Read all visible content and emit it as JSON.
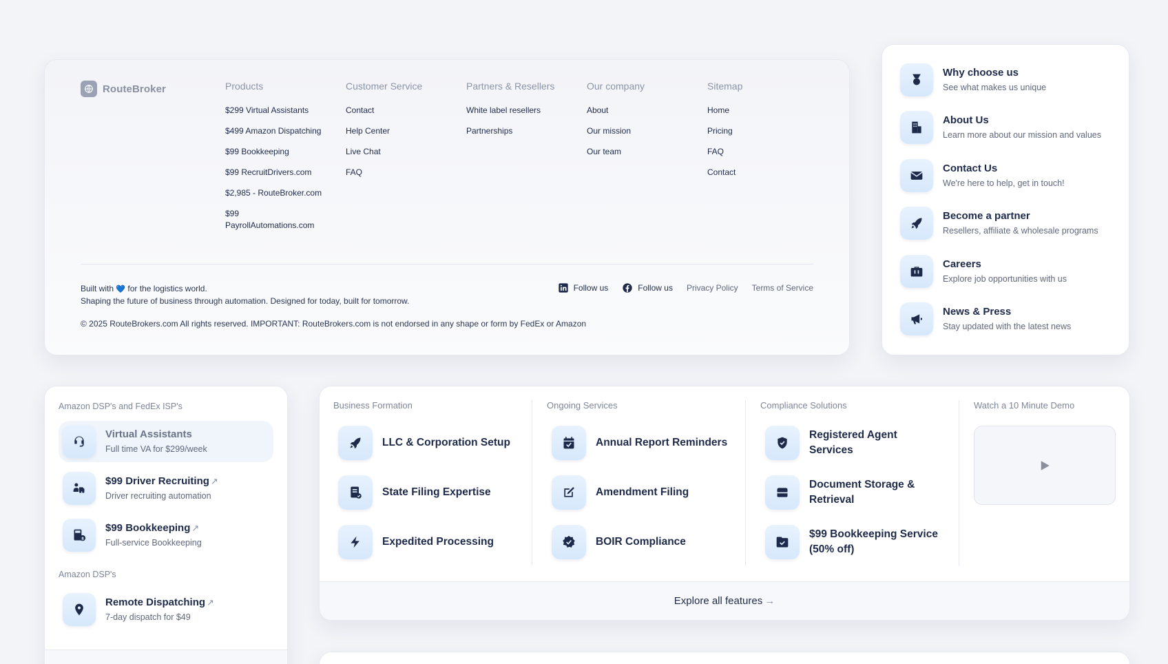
{
  "brand": {
    "name": "RouteBroker"
  },
  "footer": {
    "columns": [
      {
        "title": "Products",
        "links": [
          "$299 Virtual Assistants",
          "$499 Amazon Dispatching",
          "$99 Bookkeeping",
          "$99 RecruitDrivers.com",
          "$2,985 - RouteBroker.com",
          "$99 PayrollAutomations.com"
        ]
      },
      {
        "title": "Customer Service",
        "links": [
          "Contact",
          "Help Center",
          "Live Chat",
          "FAQ"
        ]
      },
      {
        "title": "Partners & Resellers",
        "links": [
          "White label resellers",
          "Partnerships"
        ]
      },
      {
        "title": "Our company",
        "links": [
          "About",
          "Our mission",
          "Our team"
        ]
      },
      {
        "title": "Sitemap",
        "links": [
          "Home",
          "Pricing",
          "FAQ",
          "Contact"
        ]
      }
    ],
    "built_prefix": "Built with",
    "built_suffix": "for the logistics world.",
    "tagline": "Shaping the future of business through automation. Designed for today, built for tomorrow.",
    "copyright": "© 2025 RouteBrokers.com All rights reserved. IMPORTANT: RouteBrokers.com is not endorsed in any shape or form by FedEx or Amazon",
    "linkedin_label": "Follow us",
    "facebook_label": "Follow us",
    "privacy": "Privacy Policy",
    "terms": "Terms of Service"
  },
  "company_menu": [
    {
      "title": "Why choose us",
      "sub": "See what makes us unique",
      "icon": "medal-icon"
    },
    {
      "title": "About Us",
      "sub": "Learn more about our mission and values",
      "icon": "building-icon"
    },
    {
      "title": "Contact Us",
      "sub": "We're here to help, get in touch!",
      "icon": "envelope-icon"
    },
    {
      "title": "Become a partner",
      "sub": "Resellers, affiliate & wholesale programs",
      "icon": "rocket-icon"
    },
    {
      "title": "Careers",
      "sub": "Explore job opportunities with us",
      "icon": "briefcase-icon"
    },
    {
      "title": "News & Press",
      "sub": "Stay updated with the latest news",
      "icon": "megaphone-icon"
    }
  ],
  "dsp": {
    "section1": "Amazon DSP's and FedEx ISP's",
    "items1": [
      {
        "title": "Virtual Assistants",
        "sub": "Full time VA for $299/week",
        "icon": "headset-icon"
      },
      {
        "title": "$99 Driver Recruiting",
        "sub": "Driver recruiting automation",
        "icon": "truck-user-icon"
      },
      {
        "title": "$99 Bookkeeping",
        "sub": "Full-service Bookkeeping",
        "icon": "calculator-icon"
      }
    ],
    "section2": "Amazon DSP's",
    "items2": [
      {
        "title": "Remote Dispatching",
        "sub": "7-day dispatch for $49",
        "icon": "map-pin-icon"
      }
    ]
  },
  "services": {
    "columns": [
      {
        "title": "Business Formation",
        "items": [
          "LLC & Corporation Setup",
          "State Filing Expertise",
          "Expedited Processing"
        ]
      },
      {
        "title": "Ongoing Services",
        "items": [
          "Annual Report Reminders",
          "Amendment Filing",
          "BOIR Compliance"
        ]
      },
      {
        "title": "Compliance Solutions",
        "items": [
          "Registered Agent Services",
          "Document Storage & Retrieval",
          "$99 Bookkeeping Service (50% off)"
        ]
      }
    ],
    "demo_title": "Watch a 10 Minute Demo",
    "explore": "Explore all features"
  }
}
